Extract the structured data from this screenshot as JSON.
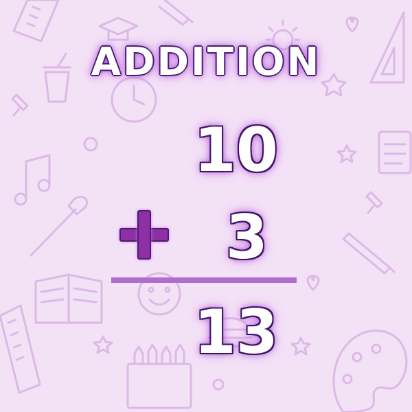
{
  "title": "ADDITION",
  "operands": {
    "top": "10",
    "bottom": "3"
  },
  "operator": "+",
  "result": "13",
  "colors": {
    "background": "#f3e1f6",
    "doodle": "#dcb9e6",
    "text_fill": "#ffffff",
    "text_outline": "#4a1b73",
    "glow": "#c97fe6",
    "plus_sign": "#8f2fa6",
    "sum_line": "#b06dd0"
  },
  "decorations": [
    "ruler-icon",
    "pencil-icon",
    "graduation-cap-icon",
    "lightbulb-icon",
    "heart-icon",
    "triangle-ruler-icon",
    "cup-icon",
    "pushpin-icon",
    "clock-icon",
    "calendar-icon",
    "music-note-icon",
    "paintbrush-icon",
    "open-book-icon",
    "smiley-icon",
    "burger-icon",
    "crayons-icon",
    "palette-icon",
    "star-icon"
  ]
}
